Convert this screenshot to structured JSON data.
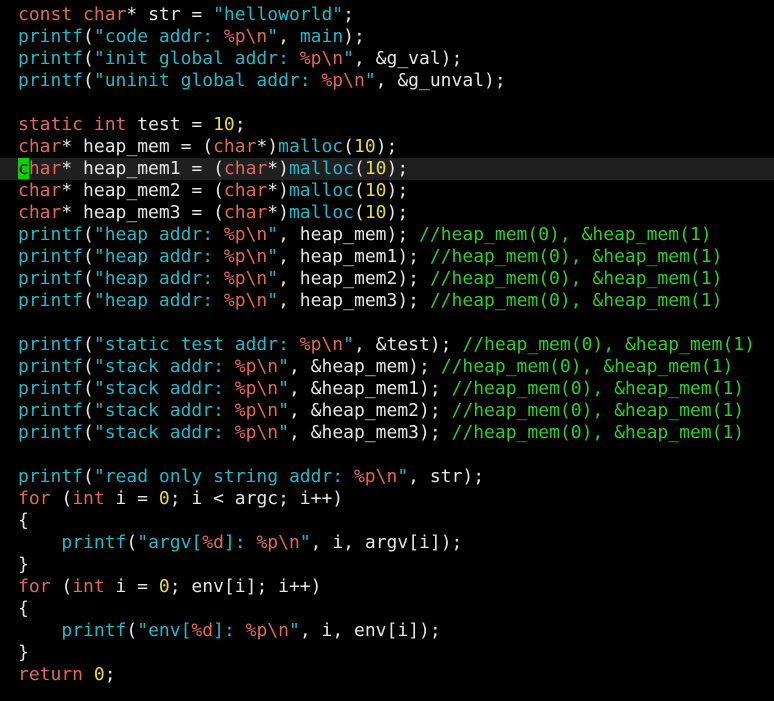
{
  "editor": {
    "cursor": {
      "line": 7,
      "col": 0
    },
    "colors": {
      "background": "#000000",
      "keyword": "#e2665f",
      "type": "#e2665f",
      "function": "#24b8c6",
      "string": "#24b8c6",
      "escape": "#e2665f",
      "number": "#e0d94d",
      "comment": "#2ecc2e",
      "text": "#e5e5e5",
      "cursor": "#00d400"
    },
    "lines": [
      [
        [
          "kw",
          "const"
        ],
        [
          "p",
          " "
        ],
        [
          "ty",
          "char"
        ],
        [
          "p",
          "* str = "
        ],
        [
          "str",
          "\"helloworld\""
        ],
        [
          "p",
          ";"
        ]
      ],
      [
        [
          "fn",
          "printf"
        ],
        [
          "p",
          "("
        ],
        [
          "str",
          "\"code addr: "
        ],
        [
          "esc",
          "%p\\n"
        ],
        [
          "str",
          "\""
        ],
        [
          "p",
          ", "
        ],
        [
          "fn",
          "main"
        ],
        [
          "p",
          ");"
        ]
      ],
      [
        [
          "fn",
          "printf"
        ],
        [
          "p",
          "("
        ],
        [
          "str",
          "\"init global addr: "
        ],
        [
          "esc",
          "%p\\n"
        ],
        [
          "str",
          "\""
        ],
        [
          "p",
          ", &g_val);"
        ]
      ],
      [
        [
          "fn",
          "printf"
        ],
        [
          "p",
          "("
        ],
        [
          "str",
          "\"uninit global addr: "
        ],
        [
          "esc",
          "%p\\n"
        ],
        [
          "str",
          "\""
        ],
        [
          "p",
          ", &g_unval);"
        ]
      ],
      [],
      [
        [
          "kw",
          "static"
        ],
        [
          "p",
          " "
        ],
        [
          "ty",
          "int"
        ],
        [
          "p",
          " test = "
        ],
        [
          "num",
          "10"
        ],
        [
          "p",
          ";"
        ]
      ],
      [
        [
          "ty",
          "char"
        ],
        [
          "p",
          "* heap_mem = ("
        ],
        [
          "ty",
          "char"
        ],
        [
          "p",
          "*)"
        ],
        [
          "fn",
          "malloc"
        ],
        [
          "p",
          "("
        ],
        [
          "num",
          "10"
        ],
        [
          "p",
          ");"
        ]
      ],
      [
        [
          "ty",
          "char"
        ],
        [
          "p",
          "* heap_mem1 = ("
        ],
        [
          "ty",
          "char"
        ],
        [
          "p",
          "*)"
        ],
        [
          "fn",
          "malloc"
        ],
        [
          "p",
          "("
        ],
        [
          "num",
          "10"
        ],
        [
          "p",
          ");"
        ]
      ],
      [
        [
          "ty",
          "char"
        ],
        [
          "p",
          "* heap_mem2 = ("
        ],
        [
          "ty",
          "char"
        ],
        [
          "p",
          "*)"
        ],
        [
          "fn",
          "malloc"
        ],
        [
          "p",
          "("
        ],
        [
          "num",
          "10"
        ],
        [
          "p",
          ");"
        ]
      ],
      [
        [
          "ty",
          "char"
        ],
        [
          "p",
          "* heap_mem3 = ("
        ],
        [
          "ty",
          "char"
        ],
        [
          "p",
          "*)"
        ],
        [
          "fn",
          "malloc"
        ],
        [
          "p",
          "("
        ],
        [
          "num",
          "10"
        ],
        [
          "p",
          ");"
        ]
      ],
      [
        [
          "fn",
          "printf"
        ],
        [
          "p",
          "("
        ],
        [
          "str",
          "\"heap addr: "
        ],
        [
          "esc",
          "%p\\n"
        ],
        [
          "str",
          "\""
        ],
        [
          "p",
          ", heap_mem); "
        ],
        [
          "cm",
          "//heap_mem(0), &heap_mem(1)"
        ]
      ],
      [
        [
          "fn",
          "printf"
        ],
        [
          "p",
          "("
        ],
        [
          "str",
          "\"heap addr: "
        ],
        [
          "esc",
          "%p\\n"
        ],
        [
          "str",
          "\""
        ],
        [
          "p",
          ", heap_mem1); "
        ],
        [
          "cm",
          "//heap_mem(0), &heap_mem(1)"
        ]
      ],
      [
        [
          "fn",
          "printf"
        ],
        [
          "p",
          "("
        ],
        [
          "str",
          "\"heap addr: "
        ],
        [
          "esc",
          "%p\\n"
        ],
        [
          "str",
          "\""
        ],
        [
          "p",
          ", heap_mem2); "
        ],
        [
          "cm",
          "//heap_mem(0), &heap_mem(1)"
        ]
      ],
      [
        [
          "fn",
          "printf"
        ],
        [
          "p",
          "("
        ],
        [
          "str",
          "\"heap addr: "
        ],
        [
          "esc",
          "%p\\n"
        ],
        [
          "str",
          "\""
        ],
        [
          "p",
          ", heap_mem3); "
        ],
        [
          "cm",
          "//heap_mem(0), &heap_mem(1)"
        ]
      ],
      [],
      [
        [
          "fn",
          "printf"
        ],
        [
          "p",
          "("
        ],
        [
          "str",
          "\"static test addr: "
        ],
        [
          "esc",
          "%p\\n"
        ],
        [
          "str",
          "\""
        ],
        [
          "p",
          ", &test); "
        ],
        [
          "cm",
          "//heap_mem(0), &heap_mem(1)"
        ]
      ],
      [
        [
          "fn",
          "printf"
        ],
        [
          "p",
          "("
        ],
        [
          "str",
          "\"stack addr: "
        ],
        [
          "esc",
          "%p\\n"
        ],
        [
          "str",
          "\""
        ],
        [
          "p",
          ", &heap_mem); "
        ],
        [
          "cm",
          "//heap_mem(0), &heap_mem(1)"
        ]
      ],
      [
        [
          "fn",
          "printf"
        ],
        [
          "p",
          "("
        ],
        [
          "str",
          "\"stack addr: "
        ],
        [
          "esc",
          "%p\\n"
        ],
        [
          "str",
          "\""
        ],
        [
          "p",
          ", &heap_mem1); "
        ],
        [
          "cm",
          "//heap_mem(0), &heap_mem(1)"
        ]
      ],
      [
        [
          "fn",
          "printf"
        ],
        [
          "p",
          "("
        ],
        [
          "str",
          "\"stack addr: "
        ],
        [
          "esc",
          "%p\\n"
        ],
        [
          "str",
          "\""
        ],
        [
          "p",
          ", &heap_mem2); "
        ],
        [
          "cm",
          "//heap_mem(0), &heap_mem(1)"
        ]
      ],
      [
        [
          "fn",
          "printf"
        ],
        [
          "p",
          "("
        ],
        [
          "str",
          "\"stack addr: "
        ],
        [
          "esc",
          "%p\\n"
        ],
        [
          "str",
          "\""
        ],
        [
          "p",
          ", &heap_mem3); "
        ],
        [
          "cm",
          "//heap_mem(0), &heap_mem(1)"
        ]
      ],
      [],
      [
        [
          "fn",
          "printf"
        ],
        [
          "p",
          "("
        ],
        [
          "str",
          "\"read only string addr: "
        ],
        [
          "esc",
          "%p\\n"
        ],
        [
          "str",
          "\""
        ],
        [
          "p",
          ", str);"
        ]
      ],
      [
        [
          "kw",
          "for"
        ],
        [
          "p",
          " ("
        ],
        [
          "ty",
          "int"
        ],
        [
          "p",
          " i = "
        ],
        [
          "num",
          "0"
        ],
        [
          "p",
          "; i < argc; i++)"
        ]
      ],
      [
        [
          "p",
          "{"
        ]
      ],
      [
        [
          "p",
          "    "
        ],
        [
          "fn",
          "printf"
        ],
        [
          "p",
          "("
        ],
        [
          "str",
          "\"argv["
        ],
        [
          "esc",
          "%d"
        ],
        [
          "str",
          "]: "
        ],
        [
          "esc",
          "%p\\n"
        ],
        [
          "str",
          "\""
        ],
        [
          "p",
          ", i, argv[i]);"
        ]
      ],
      [
        [
          "p",
          "}"
        ]
      ],
      [
        [
          "kw",
          "for"
        ],
        [
          "p",
          " ("
        ],
        [
          "ty",
          "int"
        ],
        [
          "p",
          " i = "
        ],
        [
          "num",
          "0"
        ],
        [
          "p",
          "; env[i]; i++)"
        ]
      ],
      [
        [
          "p",
          "{"
        ]
      ],
      [
        [
          "p",
          "    "
        ],
        [
          "fn",
          "printf"
        ],
        [
          "p",
          "("
        ],
        [
          "str",
          "\"env["
        ],
        [
          "esc",
          "%d"
        ],
        [
          "str",
          "]: "
        ],
        [
          "esc",
          "%p\\n"
        ],
        [
          "str",
          "\""
        ],
        [
          "p",
          ", i, env[i]);"
        ]
      ],
      [
        [
          "p",
          "}"
        ]
      ],
      [
        [
          "kw",
          "return"
        ],
        [
          "p",
          " "
        ],
        [
          "num",
          "0"
        ],
        [
          "p",
          ";"
        ]
      ]
    ]
  }
}
